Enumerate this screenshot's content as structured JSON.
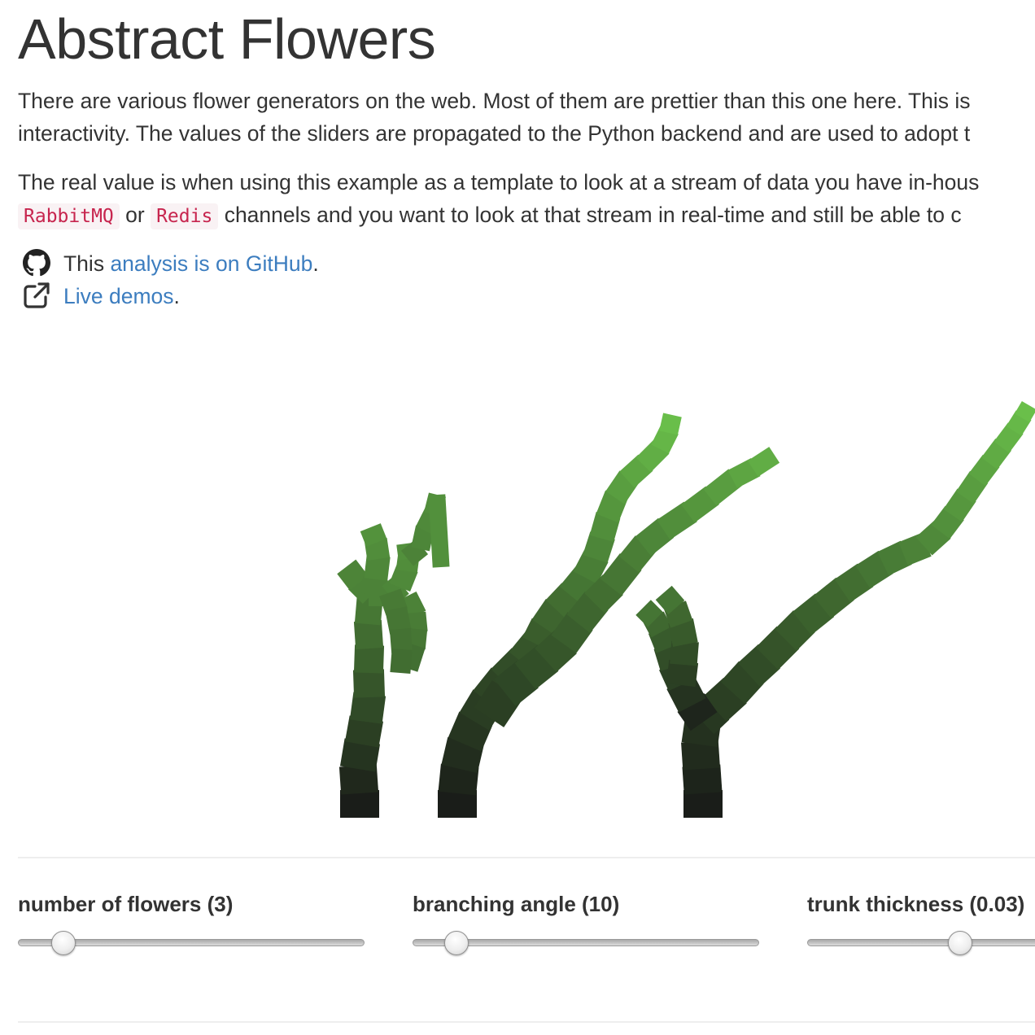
{
  "title": "Abstract Flowers",
  "paragraph1": {
    "line1": "There are various flower generators on the web. Most of them are prettier than this one here. This is",
    "line2": "interactivity. The values of the sliders are propagated to the Python backend and are used to adopt t"
  },
  "paragraph2": {
    "line1": "The real value is when using this example as a template to look at a stream of data you have in-hous",
    "code1": "RabbitMQ",
    "or_text": " or ",
    "code2": "Redis",
    "line2_rest": " channels and you want to look at that stream in real-time and still be able to c"
  },
  "links": {
    "github_prefix": "This ",
    "github_link": "analysis is on GitHub",
    "github_suffix": ".",
    "github_icon": "github-icon",
    "demos_link": "Live demos",
    "demos_suffix": ".",
    "demos_icon": "external-link-icon",
    "link_color": "#3c7dbf"
  },
  "sliders": [
    {
      "label": "number of flowers (3)",
      "fraction": 0.13
    },
    {
      "label": "branching angle (10)",
      "fraction": 0.125
    },
    {
      "label": "trunk thickness (0.03)",
      "fraction": 0.44
    }
  ],
  "colors": {
    "code_text": "#c7254e",
    "code_bg": "#f9f2f4",
    "plant_base": "#1a1d19",
    "plant_tip": "#6dc64c"
  }
}
